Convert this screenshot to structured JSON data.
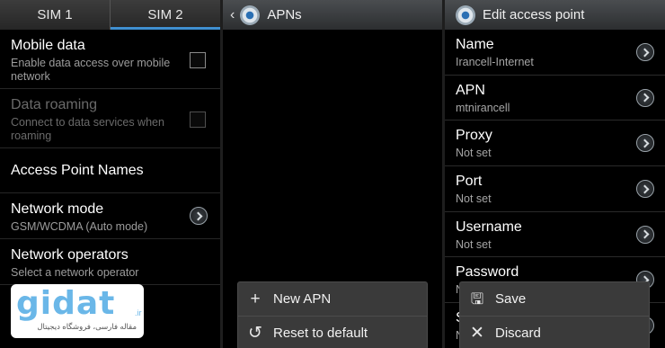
{
  "panel1": {
    "tabs": [
      {
        "label": "SIM 1",
        "active": false
      },
      {
        "label": "SIM 2",
        "active": true
      }
    ],
    "rows": {
      "mobile_data": {
        "title": "Mobile data",
        "subtitle": "Enable data access over mobile network",
        "checked": false
      },
      "data_roaming": {
        "title": "Data roaming",
        "subtitle": "Connect to data services when roaming",
        "checked": false,
        "disabled": true
      },
      "access_point_names": {
        "title": "Access Point Names"
      },
      "network_mode": {
        "title": "Network mode",
        "subtitle": "GSM/WCDMA (Auto mode)"
      },
      "network_operators": {
        "title": "Network operators",
        "subtitle": "Select a network operator"
      }
    }
  },
  "panel2": {
    "header": {
      "back_icon": "chevron-left-icon",
      "icon": "settings-gear-icon",
      "title": "APNs"
    },
    "menu": [
      {
        "label": "New APN",
        "icon": "plus-icon"
      },
      {
        "label": "Reset to default",
        "icon": "reset-icon"
      }
    ]
  },
  "panel3": {
    "header": {
      "icon": "settings-gear-icon",
      "title": "Edit access point"
    },
    "fields": [
      {
        "title": "Name",
        "value": "Irancell-Internet"
      },
      {
        "title": "APN",
        "value": "mtnirancell"
      },
      {
        "title": "Proxy",
        "value": "Not set"
      },
      {
        "title": "Port",
        "value": "Not set"
      },
      {
        "title": "Username",
        "value": "Not set"
      },
      {
        "title": "Password",
        "value": "N"
      },
      {
        "title": "S",
        "value": "N"
      }
    ],
    "menu": [
      {
        "label": "Save",
        "icon": "save-icon"
      },
      {
        "label": "Discard",
        "icon": "close-icon"
      }
    ]
  },
  "watermark": {
    "logo": "gidat",
    "domain": ".ir",
    "tagline": "مقاله فارسی، فروشگاه دیجیتال"
  },
  "colors": {
    "accent": "#3f8fd0",
    "background": "#000000",
    "subtext": "#9c9c9c"
  }
}
